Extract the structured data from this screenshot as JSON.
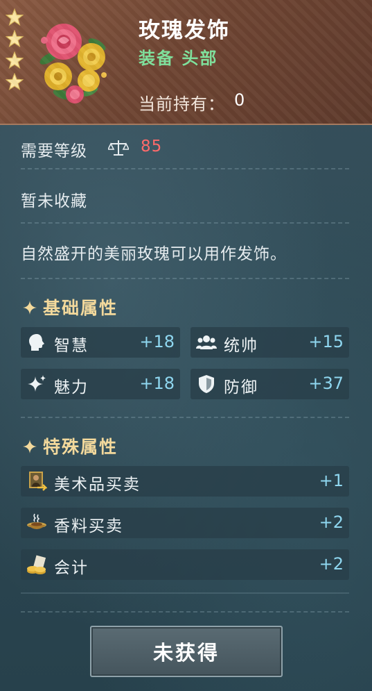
{
  "item": {
    "name": "玫瑰发饰",
    "type": "装备 头部",
    "owned_label": "当前持有：",
    "owned_count": "0",
    "stars": 4
  },
  "requirement": {
    "label": "需要等级",
    "level": "85"
  },
  "collection_status": "暂未收藏",
  "description": "自然盛开的美丽玫瑰可以用作发饰。",
  "basic": {
    "title": "基础属性",
    "stats": [
      {
        "name": "智慧",
        "value": "+18",
        "icon": "head-icon"
      },
      {
        "name": "统帅",
        "value": "+15",
        "icon": "group-icon"
      },
      {
        "name": "魅力",
        "value": "+18",
        "icon": "sparkle-icon"
      },
      {
        "name": "防御",
        "value": "+37",
        "icon": "shield-icon"
      }
    ]
  },
  "special": {
    "title": "特殊属性",
    "stats": [
      {
        "name": "美术品买卖",
        "value": "+1",
        "icon": "painting-icon"
      },
      {
        "name": "香料买卖",
        "value": "+2",
        "icon": "spice-icon"
      },
      {
        "name": "会计",
        "value": "+2",
        "icon": "coins-icon"
      }
    ]
  },
  "button": {
    "label": "未获得"
  },
  "colors": {
    "header_bg": "#6f4533",
    "item_type": "#7fe09c",
    "level_value": "#ff6b6b",
    "section_title": "#f3d99c",
    "stat_value": "#8fd7f0"
  }
}
